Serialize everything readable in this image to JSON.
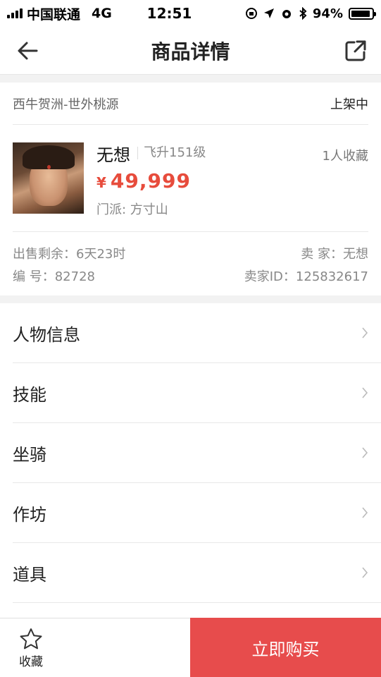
{
  "status_bar": {
    "carrier": "中国联通",
    "network": "4G",
    "time": "12:51",
    "battery": "94%",
    "battery_level": 0.94
  },
  "nav": {
    "title": "商品详情",
    "back_icon": "arrow-left-icon",
    "share_icon": "share-external-icon"
  },
  "product": {
    "server": "西牛贺洲-世外桃源",
    "listing_status": "上架中",
    "character_name": "无想",
    "level": "飞升151级",
    "favorites": "1人收藏",
    "price_symbol": "¥",
    "price": "49,999",
    "sect": "门派: 方寸山",
    "time_left_label": "出售剩余：",
    "time_left": "6天23时",
    "seller_label": "卖 家：",
    "seller": "无想",
    "serial_label": "编 号：",
    "serial": "82728",
    "seller_id_label": "卖家ID：",
    "seller_id": "125832617"
  },
  "menu": {
    "items": [
      {
        "label": "人物信息"
      },
      {
        "label": "技能"
      },
      {
        "label": "坐骑"
      },
      {
        "label": "作坊"
      },
      {
        "label": "道具"
      }
    ]
  },
  "bottom": {
    "favorite_label": "收藏",
    "buy_label": "立即购买"
  },
  "colors": {
    "accent": "#e74c4c",
    "price": "#e74c3c"
  }
}
